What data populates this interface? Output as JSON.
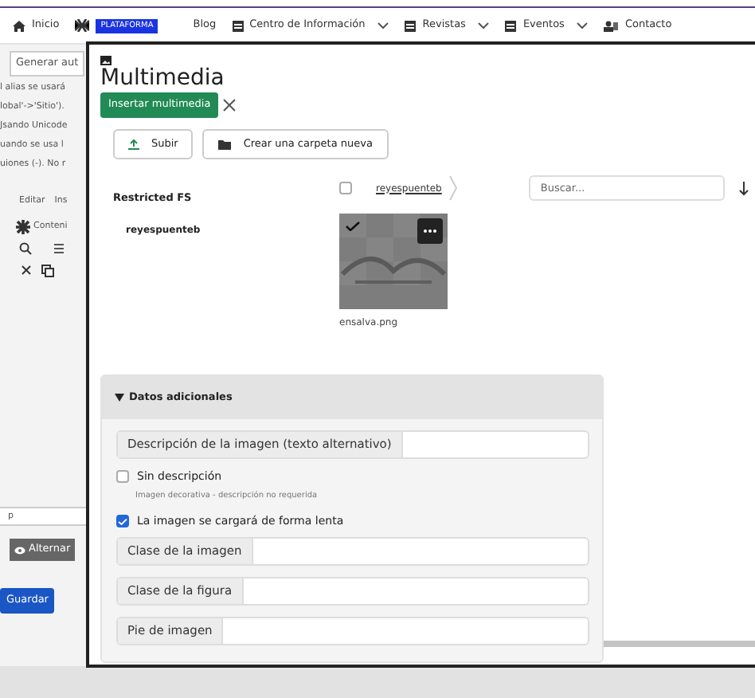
{
  "nav": {
    "items": [
      {
        "kind": "home",
        "label": "Inicio"
      },
      {
        "kind": "badge",
        "label": "PLATAFORMA"
      },
      {
        "kind": "plain",
        "label": "Blog"
      },
      {
        "kind": "menu",
        "label": "Centro de Información"
      },
      {
        "kind": "menu",
        "label": "Revistas"
      },
      {
        "kind": "menu",
        "label": "Eventos"
      },
      {
        "kind": "contact",
        "label": "Contacto"
      }
    ]
  },
  "background": {
    "tab": "Generar aut",
    "lines": [
      "l alias se usará",
      "lobal'->'Sitio').",
      "Jsando Unicode",
      "uando se usa l",
      "uiones (-). No r"
    ],
    "menu": [
      "Editar",
      "Ins"
    ],
    "toolbar_label": "Conteni",
    "field_value": "p",
    "toggle_button": "Alternar",
    "save_button": "Guardar"
  },
  "modal": {
    "title": "Multimedia",
    "insert_button": "Insertar multimedia",
    "upload_button": "Subir",
    "new_folder_button": "Crear una carpeta nueva",
    "tree": {
      "root": "Restricted FS",
      "children": [
        {
          "label": "reyespuenteb"
        }
      ]
    },
    "breadcrumb": {
      "checked": false,
      "label": "reyespuenteb"
    },
    "search": {
      "placeholder": "Buscar..."
    },
    "files": [
      {
        "name": "ensalva.png",
        "selected": true,
        "kind": "picture"
      }
    ],
    "details": {
      "title": "Datos adicionales",
      "expanded": true,
      "alt_field": {
        "label": "Descripción de la imagen (texto alternativo)"
      },
      "no_description": {
        "label": "Sin descripción",
        "hint": "Imagen decorativa - descripción no requerida",
        "checked": false
      },
      "lazy": {
        "label": "La imagen se cargará de forma lenta",
        "checked": true
      },
      "fields": [
        {
          "label": "Clase de la imagen"
        },
        {
          "label": "Clase de la figura"
        },
        {
          "label": "Pie de imagen"
        }
      ]
    }
  }
}
